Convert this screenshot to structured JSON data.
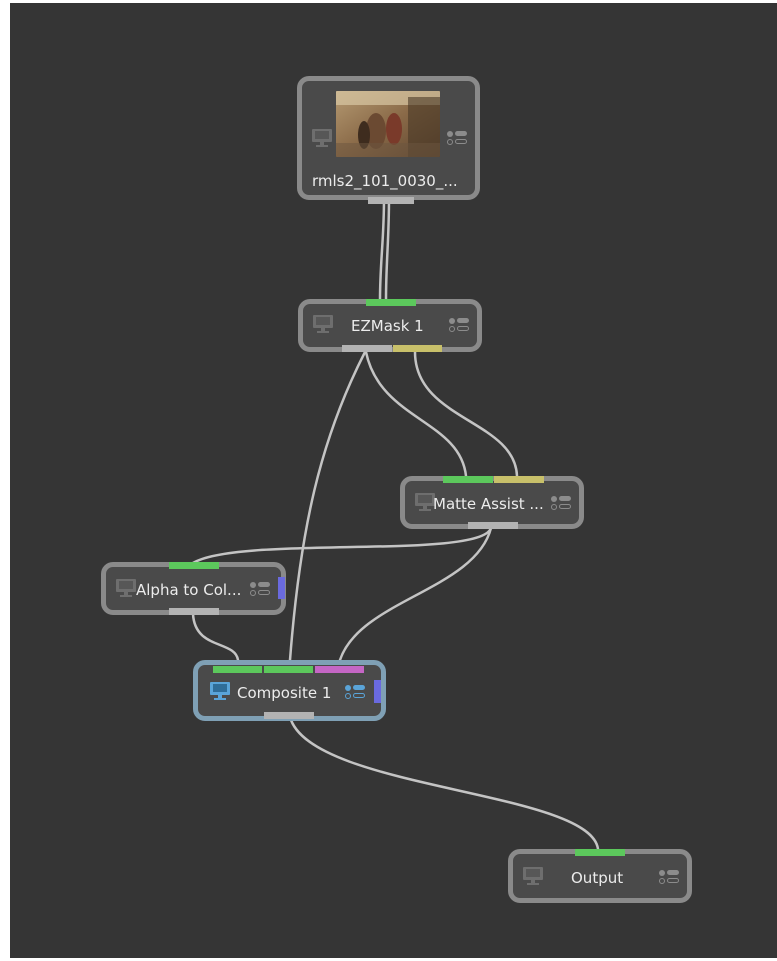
{
  "nodes": {
    "read": {
      "title": "rmls2_101_0030_...",
      "icon": "monitor-icon"
    },
    "ezmask": {
      "title": "EZMask 1",
      "icon": "monitor-icon"
    },
    "matte_assist": {
      "title": "Matte Assist ...",
      "icon": "monitor-icon"
    },
    "alpha_to_color": {
      "title": "Alpha to Col...",
      "icon": "monitor-icon"
    },
    "composite": {
      "title": "Composite 1",
      "icon": "monitor-icon",
      "selected": true
    },
    "output": {
      "title": "Output",
      "icon": "monitor-icon"
    }
  },
  "colors": {
    "canvas": "#353535",
    "node_fill": "#4a4a4a",
    "node_border": "#8a8a8a",
    "selected_border": "#7fa0b5",
    "input_port": "#5cc85c",
    "matte_port": "#c8c06a",
    "magenta_port": "#c566c5",
    "output_port": "#b3b3b3",
    "side_port": "#6a6adf",
    "wire": "#c8c8c8",
    "viewer_icon_active": "#5aa4d8"
  }
}
